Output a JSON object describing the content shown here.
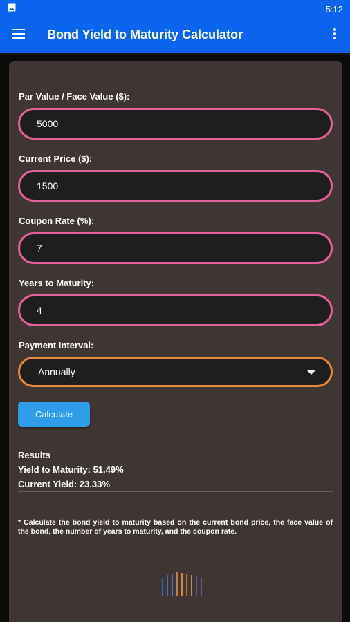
{
  "status_bar": {
    "time": "5:12",
    "image_icon": "image-icon",
    "color": "#0a64f0"
  },
  "app_bar": {
    "title": "Bond Yield to Maturity Calculator",
    "menu_icon": "hamburger-menu-icon",
    "more_icon": "more-vert-icon"
  },
  "form": {
    "par_value": {
      "label": "Par Value / Face Value ($):",
      "value": "5000"
    },
    "current_price": {
      "label": "Current Price ($):",
      "value": "1500"
    },
    "coupon_rate": {
      "label": "Coupon Rate (%):",
      "value": "7"
    },
    "years_to_maturity": {
      "label": "Years to Maturity:",
      "value": "4"
    },
    "payment_interval": {
      "label": "Payment Interval:",
      "selected": "Annually"
    },
    "calculate_label": "Calculate"
  },
  "results": {
    "title": "Results",
    "ytm": "Yield to Maturity: 51.49%",
    "current_yield": "Current Yield: 23.33%"
  },
  "footnote": "* Calculate the bond yield to maturity based on the current bond price, the face value of the bond, the number of years to maturity, and the coupon rate.",
  "colors": {
    "primary": "#0a64f0",
    "card": "#3f3532",
    "input_border": "#e3609b",
    "select_border": "#e6883a",
    "button": "#2f9de9"
  }
}
